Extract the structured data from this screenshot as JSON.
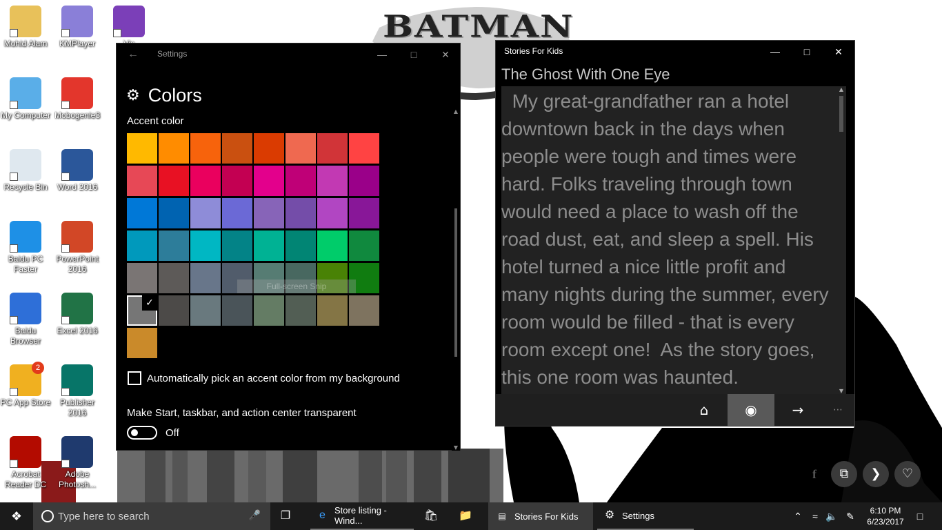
{
  "wallpaper": {
    "logo": "BATMAN"
  },
  "desktop_icons": [
    {
      "name": "Mohid Alam",
      "color": "#e8c15a",
      "icon": "user-folder-icon"
    },
    {
      "name": "KMPlayer",
      "color": "#8a7fd8",
      "icon": "kmplayer-icon"
    },
    {
      "name": "Vis",
      "color": "#7b3fb8",
      "icon": "visual-studio-icon"
    },
    {
      "name": "My Computer",
      "color": "#5aaee8",
      "icon": "computer-icon"
    },
    {
      "name": "Mobogenie3",
      "color": "#e3362c",
      "icon": "mobogenie-icon"
    },
    {
      "name": "Recycle Bin",
      "color": "#dfe8ef",
      "icon": "recycle-bin-icon"
    },
    {
      "name": "Word 2016",
      "color": "#2b579a",
      "icon": "word-icon"
    },
    {
      "name": "Baidu PC Faster",
      "color": "#1e90e6",
      "icon": "baidu-pc-faster-icon"
    },
    {
      "name": "PowerPoint 2016",
      "color": "#d24726",
      "icon": "powerpoint-icon"
    },
    {
      "name": "Baidu Browser",
      "color": "#2e6fd8",
      "icon": "baidu-browser-icon"
    },
    {
      "name": "Excel 2016",
      "color": "#217346",
      "icon": "excel-icon"
    },
    {
      "name": "PC App Store",
      "color": "#f0b020",
      "icon": "pc-app-store-icon",
      "badge": "2"
    },
    {
      "name": "Publisher 2016",
      "color": "#077568",
      "icon": "publisher-icon"
    },
    {
      "name": "Acrobat Reader DC",
      "color": "#b30b00",
      "icon": "acrobat-icon"
    },
    {
      "name": "Adobe Photosh...",
      "color": "#1f3a6e",
      "icon": "photoshop-icon"
    }
  ],
  "settings": {
    "window_title": "Settings",
    "heading": "Colors",
    "accent_label": "Accent color",
    "swatches": [
      [
        "#FFB900",
        "#FF8C00",
        "#F7630C",
        "#CA5010",
        "#DA3B01",
        "#EF6950",
        "#D13438",
        "#FF4343"
      ],
      [
        "#E74856",
        "#E81123",
        "#EA005E",
        "#C30052",
        "#E3008C",
        "#BF0077",
        "#C239B3",
        "#9A0089"
      ],
      [
        "#0078D7",
        "#0063B1",
        "#8E8CD8",
        "#6B69D6",
        "#8764B8",
        "#744DA9",
        "#B146C2",
        "#881798"
      ],
      [
        "#0099BC",
        "#2D7D9A",
        "#00B7C3",
        "#038387",
        "#00B294",
        "#018574",
        "#00CC6A",
        "#10893E"
      ],
      [
        "#7A7574",
        "#5D5A58",
        "#68768A",
        "#515C6B",
        "#567C73",
        "#486860",
        "#498205",
        "#107C10"
      ],
      [
        "#767676",
        "#4C4A48",
        "#69797E",
        "#4A5459",
        "#647C64",
        "#525E54",
        "#847545",
        "#7E735F"
      ],
      [
        "#CA8A2A"
      ]
    ],
    "selected_swatch": {
      "row": 5,
      "col": 0
    },
    "snip_label": "Full-screen Snip",
    "auto_pick_label": "Automatically pick an accent color from my background",
    "transparency_label": "Make Start, taskbar, and action center transparent",
    "toggle_state": "Off"
  },
  "stories": {
    "window_title": "Stories For Kids",
    "story_title": "The Ghost With One Eye",
    "story_text": "  My great-grandfather ran a hotel downtown back in the days when people were tough and times were hard. Folks traveling through town would need a place to wash off the road dust, eat, and sleep a spell. His hotel turned a nice little profit and many nights during the summer, every room would be filled - that is every room except one!  As the story goes, this one room was haunted."
  },
  "taskbar": {
    "search_placeholder": "Type here to search",
    "items": [
      {
        "label": "Store listing - Wind...",
        "icon": "edge-icon"
      },
      {
        "label": "Stories For Kids",
        "icon": "stories-app-icon"
      },
      {
        "label": "Settings",
        "icon": "gear-icon"
      }
    ],
    "time": "6:10 PM",
    "date": "6/23/2017"
  }
}
